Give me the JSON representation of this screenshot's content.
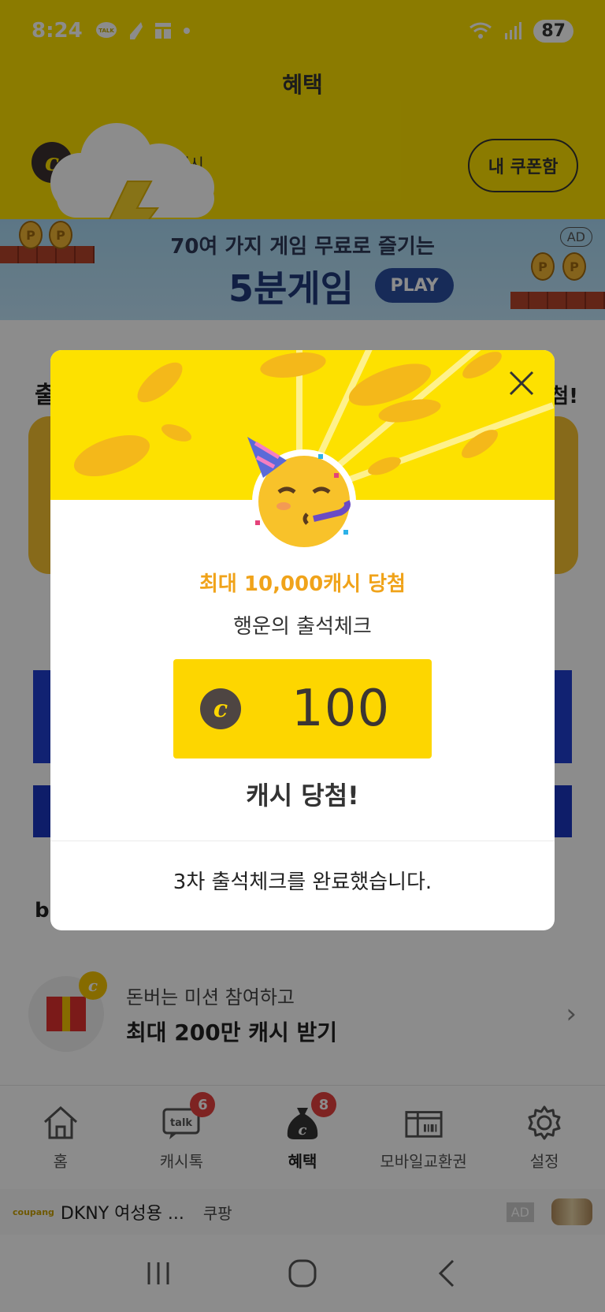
{
  "status_bar": {
    "time": "8:24",
    "left_icons": [
      "talk-icon",
      "feather-icon",
      "grid-icon",
      "dot-icon"
    ],
    "battery": "87"
  },
  "header": {
    "title": "혜택",
    "cash_label": "캐시",
    "coupon_button": "내 쿠폰함"
  },
  "banner_ad": {
    "line1": "70여 가지 게임 무료로 즐기는",
    "line2": "5분게임",
    "play": "PLAY",
    "ad_badge": "AD"
  },
  "background_content": {
    "section_title_partial": "출",
    "section_title_right_partial": "첨!",
    "section_b_partial": "b"
  },
  "mission": {
    "sub": "돈버는 미션 참여하고",
    "main": "최대 200만 캐시 받기"
  },
  "bottom_nav": {
    "items": [
      {
        "label": "홈",
        "icon": "home-icon",
        "badge": null
      },
      {
        "label": "캐시톡",
        "icon": "talk-bubble-icon",
        "badge": "6"
      },
      {
        "label": "혜택",
        "icon": "cash-bag-icon",
        "badge": "8",
        "active": true
      },
      {
        "label": "모바일교환권",
        "icon": "voucher-icon",
        "badge": null
      },
      {
        "label": "설정",
        "icon": "gear-icon",
        "badge": null
      }
    ]
  },
  "ad_strip": {
    "logo": "coupang",
    "title": "DKNY 여성용 ...",
    "source": "쿠팡",
    "badge": "AD"
  },
  "modal": {
    "promo": "최대 10,000캐시 당첨",
    "subtitle": "행운의 출석체크",
    "amount": "100",
    "coin_symbol": "c",
    "win_text": "캐시 당첨!",
    "footer": "3차 출석체크를 완료했습니다."
  },
  "colors": {
    "brand_yellow": "#fde100",
    "promo_orange": "#f0a31a",
    "badge_red": "#e5413e"
  }
}
